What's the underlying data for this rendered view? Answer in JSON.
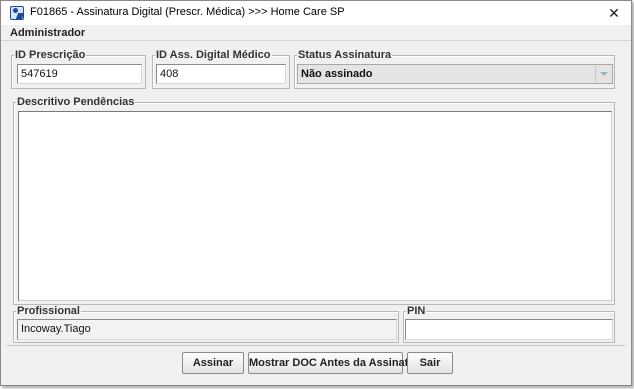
{
  "window": {
    "title": "F01865 - Assinatura Digital (Prescr. Médica) >>> Home Care SP",
    "close_glyph": "✕"
  },
  "menu": {
    "items": [
      "Administrador"
    ]
  },
  "fields": {
    "id_prescricao": {
      "label": "ID Prescrição",
      "value": "547619"
    },
    "id_ass_digital": {
      "label": "ID Ass. Digital Médico",
      "value": "408"
    },
    "status_assinatura": {
      "label": "Status Assinatura",
      "value": "Não assinado"
    },
    "descritivo_pendencias": {
      "label": "Descritivo Pendências",
      "value": ""
    },
    "profissional": {
      "label": "Profissional",
      "value": "Incoway.Tiago"
    },
    "pin": {
      "label": "PIN",
      "value": ""
    }
  },
  "buttons": {
    "assinar": "Assinar",
    "mostrar_doc": "Mostrar DOC Antes da Assinatura",
    "sair": "Sair"
  },
  "icons": {
    "app": "signature-app-icon",
    "close": "close-icon",
    "dropdown": "chevron-down-icon"
  }
}
